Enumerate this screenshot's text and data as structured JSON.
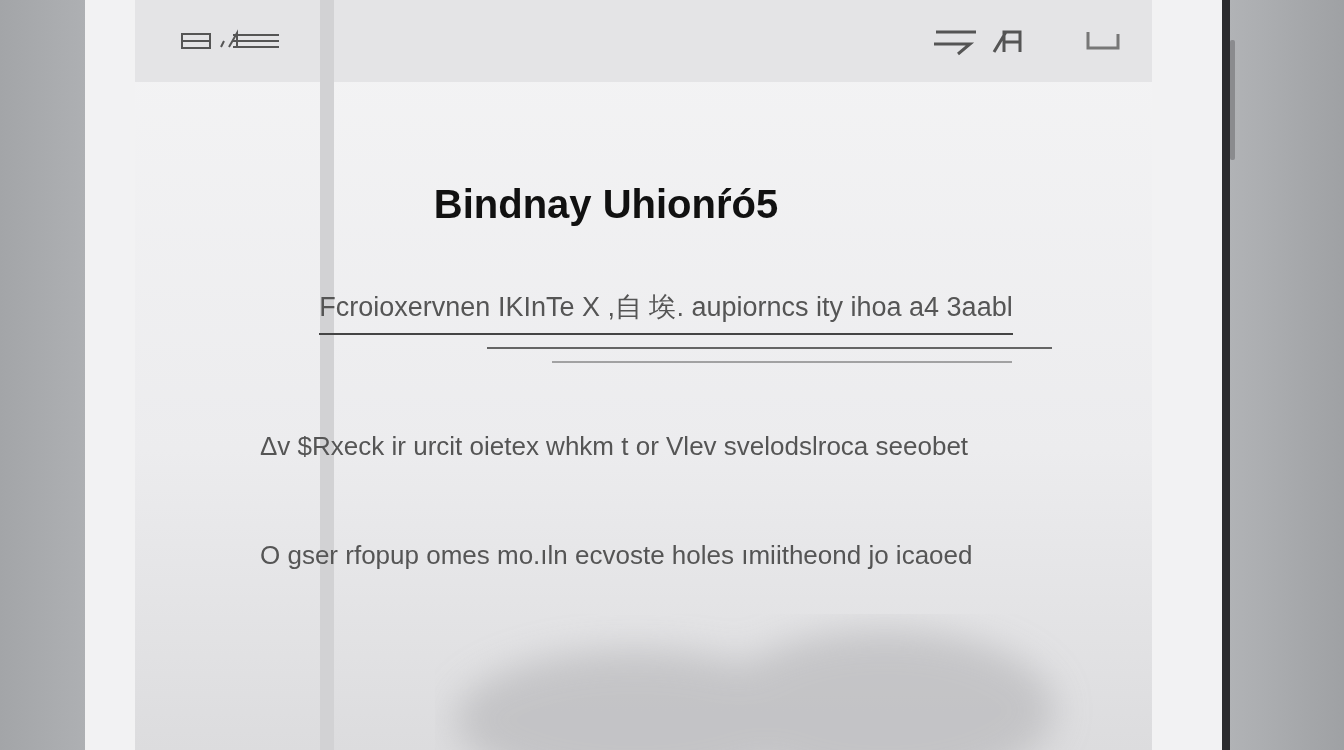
{
  "screen": {
    "title": "Bindnay Uhionŕó5",
    "subtitle": "Fcroioxervnen IKInTe X ,自 埃. aupiorncs ity ihoa a4 3aabl",
    "lines": [
      "Δv $Rxeck ir urcit oietex whkm t or Vlev svelodslroca seeobet",
      "O gser rfopup omes mo.ıln ecvoste holes ımiitheond jo icaoed"
    ]
  }
}
